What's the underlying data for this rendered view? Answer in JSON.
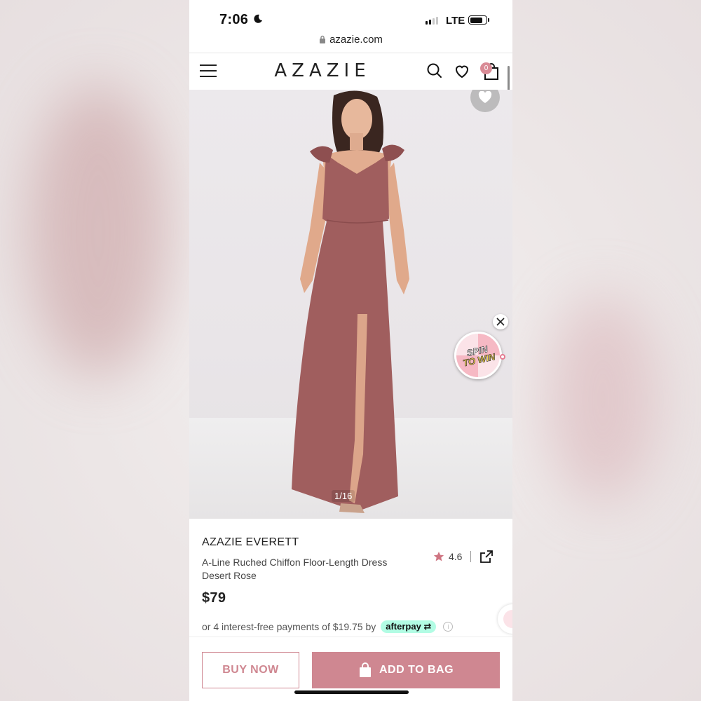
{
  "status_bar": {
    "time": "7:06",
    "network": "LTE"
  },
  "browser": {
    "url": "azazie.com"
  },
  "header": {
    "logo": "AZAZIE",
    "cart_count": "0"
  },
  "gallery": {
    "counter": "1/16"
  },
  "promo": {
    "spin_line1": "SPIN",
    "spin_line2": "TO WIN"
  },
  "product": {
    "brand": "AZAZIE EVERETT",
    "description": "A-Line Ruched Chiffon Floor-Length Dress Desert Rose",
    "rating": "4.6",
    "price": "$79",
    "installment_text": "or 4 interest-free payments of $19.75 by",
    "afterpay_label": "afterpay"
  },
  "actions": {
    "buy_now": "BUY NOW",
    "add_to_bag": "ADD TO BAG"
  },
  "colors": {
    "accent": "#cf8791",
    "dress": "#a05e5e",
    "badge": "#d98b96"
  }
}
